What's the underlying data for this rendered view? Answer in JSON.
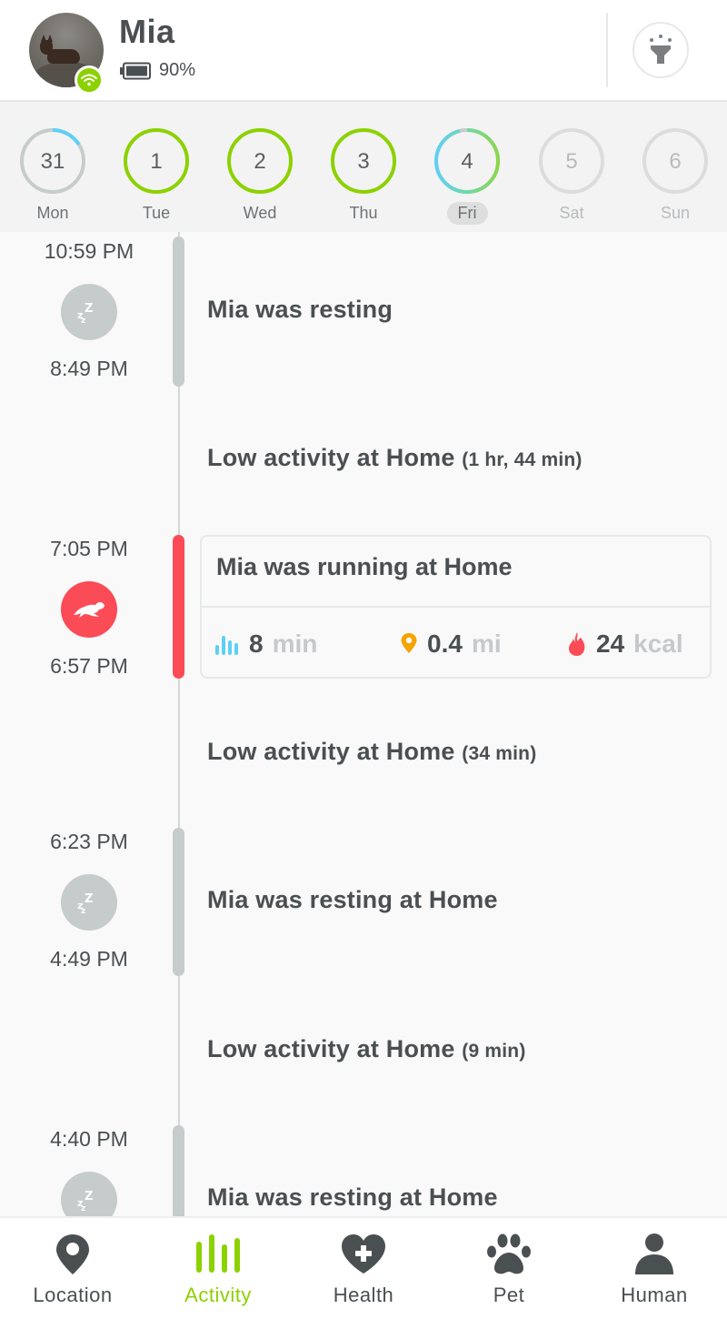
{
  "header": {
    "pet_name": "Mia",
    "battery_percent": "90%",
    "connection_status": "wifi-connected",
    "light_button_icon": "flashlight-icon"
  },
  "week": {
    "days": [
      {
        "date": "31",
        "label": "Mon",
        "state": "past",
        "goal_progress": 0.16
      },
      {
        "date": "1",
        "label": "Tue",
        "state": "complete",
        "goal_progress": 1.0
      },
      {
        "date": "2",
        "label": "Wed",
        "state": "complete",
        "goal_progress": 1.0
      },
      {
        "date": "3",
        "label": "Thu",
        "state": "complete",
        "goal_progress": 1.0
      },
      {
        "date": "4",
        "label": "Fri",
        "state": "selected",
        "goal_progress": 0.96
      },
      {
        "date": "5",
        "label": "Sat",
        "state": "future",
        "goal_progress": 0
      },
      {
        "date": "6",
        "label": "Sun",
        "state": "future",
        "goal_progress": 0
      }
    ]
  },
  "timeline": {
    "events": [
      {
        "type": "rest",
        "start": "10:59 PM",
        "end": "8:49 PM",
        "title": "Mia was resting",
        "icon": "sleep-icon"
      },
      {
        "type": "low",
        "title": "Low activity at Home",
        "duration": "(1 hr, 44 min)"
      },
      {
        "type": "run",
        "start": "7:05 PM",
        "end": "6:57 PM",
        "title": "Mia was running at Home",
        "icon": "running-dog-icon",
        "stats": [
          {
            "icon": "activity-bars-icon",
            "value": "8",
            "unit": "min",
            "color": "#5fd0f5"
          },
          {
            "icon": "location-pin-icon",
            "value": "0.4",
            "unit": "mi",
            "color": "#f5a300"
          },
          {
            "icon": "flame-icon",
            "value": "24",
            "unit": "kcal",
            "color": "#fb4b56"
          }
        ]
      },
      {
        "type": "low",
        "title": "Low activity at Home",
        "duration": "(34 min)"
      },
      {
        "type": "rest",
        "start": "6:23 PM",
        "end": "4:49 PM",
        "title": "Mia was resting at Home",
        "icon": "sleep-icon"
      },
      {
        "type": "low",
        "title": "Low activity at Home",
        "duration": "(9 min)"
      },
      {
        "type": "rest",
        "start": "4:40 PM",
        "end": "",
        "title": "Mia was resting at Home",
        "icon": "sleep-icon"
      }
    ]
  },
  "nav": {
    "items": [
      {
        "label": "Location",
        "icon": "location-pin-icon",
        "active": false
      },
      {
        "label": "Activity",
        "icon": "activity-bars-icon",
        "active": true
      },
      {
        "label": "Health",
        "icon": "heart-plus-icon",
        "active": false
      },
      {
        "label": "Pet",
        "icon": "paw-icon",
        "active": false
      },
      {
        "label": "Human",
        "icon": "person-icon",
        "active": false
      }
    ]
  },
  "colors": {
    "accent_green": "#8cd100",
    "run_red": "#fb4b56",
    "rest_gray": "#c6cbcc",
    "goal_blue": "#5fd0f5",
    "text": "#4a4f52"
  }
}
